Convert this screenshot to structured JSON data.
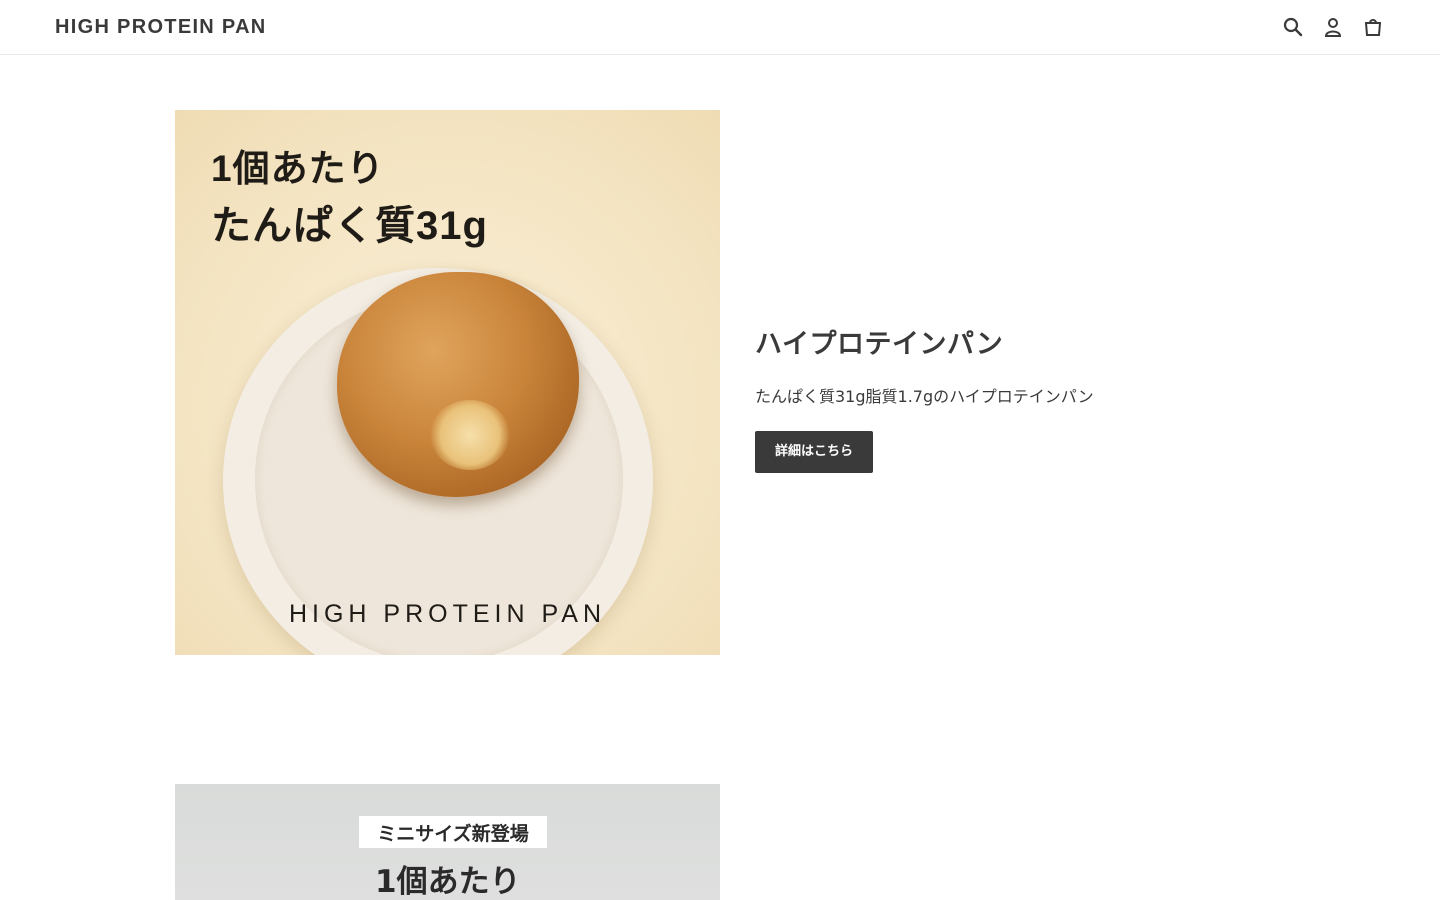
{
  "header": {
    "logo": "HIGH PROTEIN PAN",
    "icons": [
      "search-icon",
      "account-icon",
      "cart-icon"
    ]
  },
  "feature1": {
    "image_text_line1": "1個あたり",
    "image_text_line2": "たんぱく質31g",
    "image_brand": "HIGH PROTEIN PAN",
    "title": "ハイプロテインパン",
    "description": "たんぱく質31g脂質1.7gのハイプロテインパン",
    "button_label": "詳細はこちら"
  },
  "feature2": {
    "badge": "ミニサイズ新登場",
    "image_text_line1": "1個あたり"
  },
  "colors": {
    "button_bg": "#3a3a3a",
    "text": "#3a3a3a",
    "header_border": "#e8e9eb"
  }
}
